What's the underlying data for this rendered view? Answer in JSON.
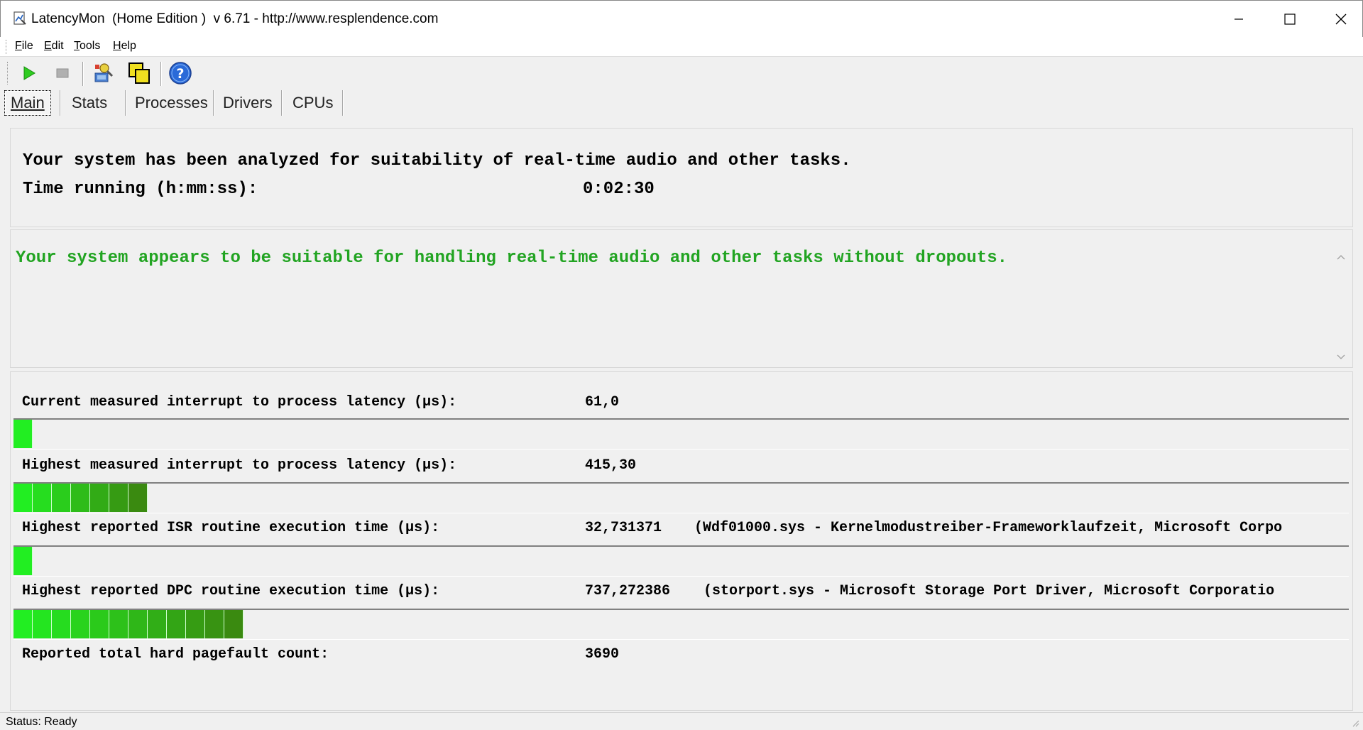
{
  "window": {
    "title": "LatencyMon  (Home Edition )  v 6.71 - http://www.resplendence.com"
  },
  "menu": [
    {
      "label": "File",
      "accel": "F",
      "rest": "ile"
    },
    {
      "label": "Edit",
      "accel": "E",
      "rest": "dit"
    },
    {
      "label": "Tools",
      "accel": "T",
      "rest": "ools"
    },
    {
      "label": "Help",
      "accel": "H",
      "rest": "elp"
    }
  ],
  "toolbar": {
    "icons": [
      "play-icon",
      "stop-icon",
      "driver-search-icon",
      "cpu-windows-icon",
      "help-icon"
    ]
  },
  "tabs": [
    {
      "label": "Main",
      "active": true
    },
    {
      "label": "Stats",
      "active": false
    },
    {
      "label": "Processes",
      "active": false
    },
    {
      "label": "Drivers",
      "active": false
    },
    {
      "label": "CPUs",
      "active": false
    }
  ],
  "summary": {
    "analyzed_text": "Your system has been analyzed for suitability of real-time audio and other tasks.",
    "time_label": "Time running (h:mm:ss):",
    "time_value": "0:02:30"
  },
  "verdict": {
    "text": "Your system appears to be suitable for handling real-time audio and other tasks without dropouts.",
    "color": "#22a422"
  },
  "metrics": [
    {
      "label": "Current measured interrupt to process latency (µs):",
      "value": "61,0",
      "detail": "",
      "bar_segments": 1
    },
    {
      "label": "Highest measured interrupt to process latency (µs):",
      "value": "415,30",
      "detail": "",
      "bar_segments": 7
    },
    {
      "label": "Highest reported ISR routine execution time (µs):",
      "value": "32,731371",
      "detail": "(Wdf01000.sys - Kernelmodustreiber-Frameworklaufzeit, Microsoft Corpo",
      "bar_segments": 1
    },
    {
      "label": "Highest reported DPC routine execution time (µs):",
      "value": "737,272386",
      "detail": "(storport.sys - Microsoft Storage Port Driver, Microsoft Corporatio",
      "bar_segments": 12
    },
    {
      "label": "Reported total hard pagefault count:",
      "value": "3690",
      "detail": ""
    }
  ],
  "colors": {
    "bar_light": "#22ee22",
    "bar_dark": "#3a8a10"
  },
  "status": {
    "text": "Status: Ready"
  }
}
